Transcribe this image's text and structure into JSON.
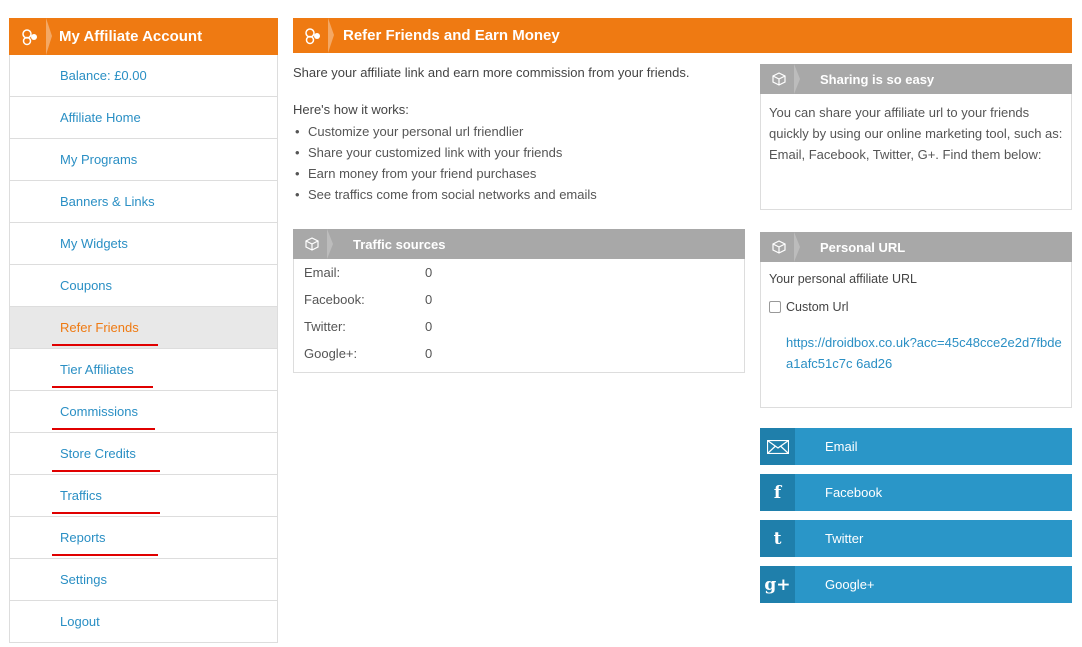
{
  "sidebar": {
    "title": "My Affiliate Account",
    "items": [
      {
        "label": "Balance: £0.00"
      },
      {
        "label": "Affiliate Home"
      },
      {
        "label": "My Programs"
      },
      {
        "label": "Banners & Links"
      },
      {
        "label": "My Widgets"
      },
      {
        "label": "Coupons"
      },
      {
        "label": "Refer Friends"
      },
      {
        "label": "Tier Affiliates"
      },
      {
        "label": "Commissions"
      },
      {
        "label": "Store Credits"
      },
      {
        "label": "Traffics"
      },
      {
        "label": "Reports"
      },
      {
        "label": "Settings"
      },
      {
        "label": "Logout"
      }
    ]
  },
  "main": {
    "title": "Refer Friends and Earn Money",
    "lead": "Share your affiliate link and earn more commission from your friends.",
    "how_title": "Here's how it works:",
    "steps": [
      "Customize your personal url friendlier",
      "Share your customized link with your friends",
      "Earn money from your friend purchases",
      "See traffics come from social networks and emails"
    ]
  },
  "traffic": {
    "title": "Traffic sources",
    "rows": [
      {
        "label": "Email:",
        "value": "0"
      },
      {
        "label": "Facebook:",
        "value": "0"
      },
      {
        "label": "Twitter:",
        "value": "0"
      },
      {
        "label": "Google+:",
        "value": "0"
      }
    ]
  },
  "sharing": {
    "title": "Sharing is so easy",
    "body": "You can share your affiliate url to your friends quickly by using our online marketing tool, such as: Email, Facebook, Twitter, G+. Find them below:"
  },
  "personal": {
    "title": "Personal URL",
    "label": "Your personal affiliate URL",
    "custom_label": "Custom Url",
    "url": "https://droidbox.co.uk?acc=45c48cce2e2d7fbdea1afc51c7c 6ad26"
  },
  "share": [
    {
      "label": "Email",
      "icon": "✉"
    },
    {
      "label": "Facebook",
      "icon": "f"
    },
    {
      "label": "Twitter",
      "icon": "t"
    },
    {
      "label": "Google+",
      "icon": "g+"
    }
  ],
  "colors": {
    "accent": "#ef7a12",
    "link": "#2a8fc4",
    "panel_head": "#a8a8a8",
    "share_button": "#2a96c8",
    "underline": "#e00000"
  }
}
